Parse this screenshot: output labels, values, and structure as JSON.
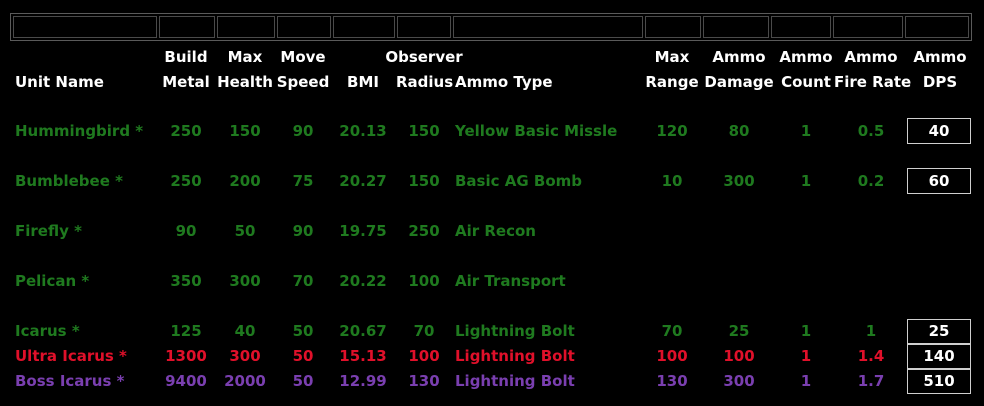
{
  "headers": {
    "unit_name": "Unit Name",
    "build_metal": [
      "Build",
      "Metal"
    ],
    "max_health": [
      "Max",
      "Health"
    ],
    "move_speed": [
      "Move",
      "Speed"
    ],
    "bmi": "BMI",
    "observer_radius": [
      "Observer",
      "Radius"
    ],
    "ammo_type": "Ammo Type",
    "max_range": [
      "Max",
      "Range"
    ],
    "ammo_damage": [
      "Ammo",
      "Damage"
    ],
    "ammo_count": [
      "Ammo",
      "Count"
    ],
    "ammo_fire_rate": [
      "Ammo",
      "Fire Rate"
    ],
    "ammo_dps": [
      "Ammo",
      "DPS"
    ]
  },
  "colors": {
    "green": "#1f7a1f",
    "red": "#e0102a",
    "purple": "#7a3fb0",
    "white": "#ffffff"
  },
  "rows": [
    {
      "name": "Hummingbird *",
      "metal": "250",
      "health": "150",
      "speed": "90",
      "bmi": "20.13",
      "radius": "150",
      "ammo": "Yellow Basic Missle",
      "range": "120",
      "damage": "80",
      "count": "1",
      "rate": "0.5",
      "dps": "40",
      "color": "green"
    },
    {
      "name": "Bumblebee *",
      "metal": "250",
      "health": "200",
      "speed": "75",
      "bmi": "20.27",
      "radius": "150",
      "ammo": "Basic AG Bomb",
      "range": "10",
      "damage": "300",
      "count": "1",
      "rate": "0.2",
      "dps": "60",
      "color": "green"
    },
    {
      "name": "Firefly *",
      "metal": "90",
      "health": "50",
      "speed": "90",
      "bmi": "19.75",
      "radius": "250",
      "ammo": "Air Recon",
      "range": "",
      "damage": "",
      "count": "",
      "rate": "",
      "dps": "",
      "color": "green"
    },
    {
      "name": "Pelican *",
      "metal": "350",
      "health": "300",
      "speed": "70",
      "bmi": "20.22",
      "radius": "100",
      "ammo": "Air Transport",
      "range": "",
      "damage": "",
      "count": "",
      "rate": "",
      "dps": "",
      "color": "green"
    },
    {
      "name": "Icarus *",
      "metal": "125",
      "health": "40",
      "speed": "50",
      "bmi": "20.67",
      "radius": "70",
      "ammo": "Lightning Bolt",
      "range": "70",
      "damage": "25",
      "count": "1",
      "rate": "1",
      "dps": "25",
      "color": "green"
    },
    {
      "name": "Ultra Icarus *",
      "metal": "1300",
      "health": "300",
      "speed": "50",
      "bmi": "15.13",
      "radius": "100",
      "ammo": "Lightning Bolt",
      "range": "100",
      "damage": "100",
      "count": "1",
      "rate": "1.4",
      "dps": "140",
      "color": "red"
    },
    {
      "name": "Boss Icarus *",
      "metal": "9400",
      "health": "2000",
      "speed": "50",
      "bmi": "12.99",
      "radius": "130",
      "ammo": "Lightning Bolt",
      "range": "130",
      "damage": "300",
      "count": "1",
      "rate": "1.7",
      "dps": "510",
      "color": "purple"
    }
  ]
}
